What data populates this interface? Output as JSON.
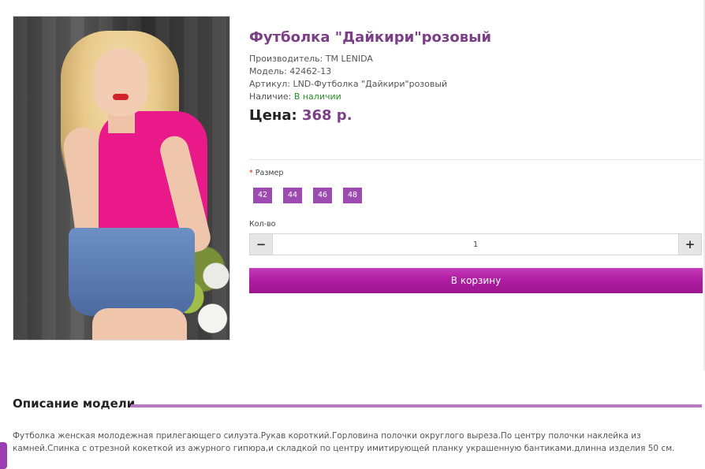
{
  "product": {
    "title": "Футболка \"Дайкири\"розовый",
    "manufacturer": "Производитель: TM LENIDA",
    "model": "Модель: 42462-13",
    "article": "Артикул: LND-Футболка \"Дайкири\"розовый",
    "availability_label": "Наличие: ",
    "availability_value": "В наличии",
    "price_label": "Цена: ",
    "price_value": "368 р."
  },
  "options": {
    "size_required_mark": "*",
    "size_label": " Размер",
    "sizes": [
      "42",
      "44",
      "46",
      "48"
    ]
  },
  "quantity": {
    "label": "Кол-во",
    "minus": "−",
    "value": "1",
    "plus": "+"
  },
  "cart": {
    "button_label": "В корзину"
  },
  "description": {
    "heading": "Описание модели",
    "text": "Футболка женская молодежная прилегающего силуэта.Рукав короткий.Горловина полочки округлого выреза.По центру полочки наклейка из камней.Спинка с отрезной кокеткой из ажурного гипюра,и складкой по центру имитирующей планку украшенную бантиками.длинна изделия 50 см."
  },
  "colors": {
    "accent": "#7a3f86",
    "size_button": "#9d4bb0",
    "cart_button": "#b01ea3",
    "in_stock": "#2d8c2d"
  }
}
